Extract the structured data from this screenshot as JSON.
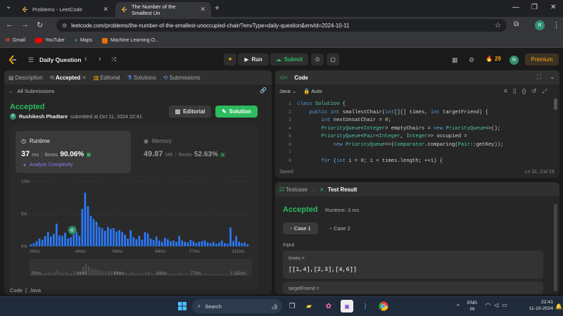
{
  "browser": {
    "tabs": [
      {
        "title": "Problems - LeetCode"
      },
      {
        "title": "The Number of the Smallest Un"
      }
    ],
    "new_tab": "+",
    "url": "leetcode.com/problems/the-number-of-the-smallest-unoccupied-chair/?envType=daily-question&envId=2024-10-11",
    "profile_initial": "R",
    "bookmarks": [
      {
        "label": "Gmail"
      },
      {
        "label": "YouTube"
      },
      {
        "label": "Maps"
      },
      {
        "label": "Machine Learning O..."
      }
    ]
  },
  "lc_nav": {
    "list_title": "Daily Question",
    "run_label": "Run",
    "submit_label": "Submit",
    "streak": "29",
    "premium": "Premium",
    "avatar": "R"
  },
  "left_tabs": [
    {
      "label": "Description"
    },
    {
      "label": "Accepted"
    },
    {
      "label": "Editorial"
    },
    {
      "label": "Solutions"
    },
    {
      "label": "Submissions"
    }
  ],
  "submission": {
    "back_label": "All Submissions",
    "status": "Accepted",
    "user": "Rushikesh Phadtare",
    "submitted_text": "submitted at Oct 11, 2024 22:41",
    "editorial_btn": "Editorial",
    "solution_btn": "Solution",
    "runtime": {
      "label": "Runtime",
      "value": "37",
      "unit": "ms",
      "beats_label": "Beats",
      "beats": "90.06%"
    },
    "memory": {
      "label": "Memory",
      "value": "49.87",
      "unit": "MB",
      "beats_label": "Beats",
      "beats": "52.63%"
    },
    "analyze": "Analyze Complexity",
    "footer": "Code  |  Java"
  },
  "histogram": {
    "y_ticks": [
      "10%",
      "5%",
      "0%"
    ],
    "x_ticks": [
      "29ms",
      "44ms",
      "54ms",
      "64ms",
      "77ms",
      "112ms"
    ],
    "overview_ticks": [
      "29ms",
      "44ms",
      "54ms",
      "64ms",
      "77ms",
      "112ms"
    ],
    "bar_color": "#2b7bff",
    "values": [
      0.3,
      0.5,
      0.8,
      1.2,
      1.0,
      1.6,
      2.2,
      1.5,
      1.9,
      3.5,
      1.7,
      1.6,
      2.1,
      1.2,
      1.4,
      2.8,
      2.2,
      1.6,
      5.8,
      8.3,
      6.2,
      4.7,
      4.2,
      3.8,
      3.0,
      2.8,
      2.4,
      3.0,
      2.7,
      2.8,
      2.3,
      2.5,
      2.2,
      1.8,
      1.2,
      2.5,
      1.4,
      1.1,
      1.6,
      1.0,
      2.2,
      2.0,
      1.2,
      1.0,
      1.5,
      0.9,
      0.7,
      1.3,
      1.1,
      0.8,
      0.9,
      0.7,
      1.6,
      0.9,
      0.7,
      0.6,
      1.0,
      0.8,
      0.5,
      0.7,
      0.8,
      0.9,
      0.6,
      0.5,
      0.7,
      0.4,
      0.6,
      0.9,
      0.5,
      0.4,
      2.9,
      0.8,
      1.6,
      0.7,
      0.5,
      0.6,
      0.3
    ],
    "marker_initial": "R"
  },
  "code_panel": {
    "title": "Code",
    "lang": "Java",
    "auto": "Auto",
    "saved": "Saved",
    "cursor": "Ln 31, Col 19",
    "line_numbers": [
      "1",
      "2",
      "3",
      "4",
      "5",
      "6",
      "7",
      "8"
    ],
    "lines": [
      "class Solution {",
      "    public int smallestChair(int[][] times, int targetFriend) {",
      "        int nextUnsatChair = 0;",
      "        PriorityQueue<Integer> emptyChairs = new PriorityQueue<>();",
      "        PriorityQueue<Pair<Integer, Integer>> occupied =",
      "            new PriorityQueue<>(Comparator.comparing(Pair::getKey));",
      "",
      "        for (int i = 0; i < times.length; ++i) {"
    ]
  },
  "test_panel": {
    "testcase_tab": "Testcase",
    "result_tab": "Test Result",
    "status": "Accepted",
    "runtime": "Runtime: 3 ms",
    "cases": [
      {
        "label": "Case 1"
      },
      {
        "label": "Case 2"
      }
    ],
    "input_label": "Input",
    "var1_name": "times =",
    "var1_value": "[[1,4],[2,3],[4,6]]",
    "var2_name": "targetFriend ="
  },
  "taskbar": {
    "search": "Search",
    "lang_line1": "ENG",
    "lang_line2": "IN",
    "time": "22:41",
    "date": "11-10-2024"
  }
}
